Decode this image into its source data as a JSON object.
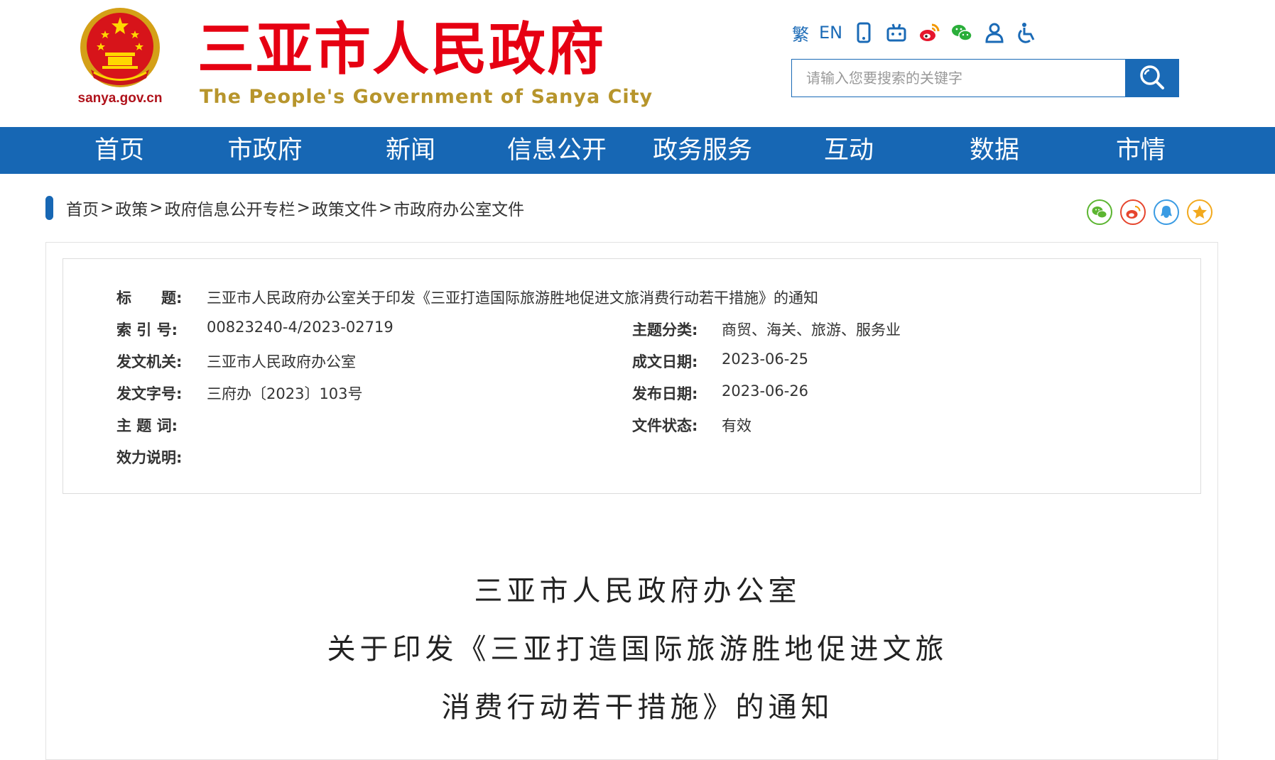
{
  "header": {
    "emblem_caption": "sanya.gov.cn",
    "site_title": "三亚市人民政府",
    "site_subtitle": "The People's Government of Sanya City",
    "tools": {
      "traditional": "繁",
      "english": "EN",
      "icons": [
        "mobile-icon",
        "robot-icon",
        "weibo-icon",
        "wechat-icon",
        "user-icon",
        "accessibility-icon"
      ]
    },
    "search": {
      "placeholder": "请输入您要搜索的关键字"
    }
  },
  "nav": {
    "items": [
      {
        "label": "首页"
      },
      {
        "label": "市政府"
      },
      {
        "label": "新闻"
      },
      {
        "label": "信息公开"
      },
      {
        "label": "政务服务"
      },
      {
        "label": "互动"
      },
      {
        "label": "数据"
      },
      {
        "label": "市情"
      }
    ]
  },
  "breadcrumb": {
    "items": [
      "首页",
      "政策",
      "政府信息公开专栏",
      "政策文件",
      "市政府办公室文件"
    ],
    "separator": ">"
  },
  "share": {
    "icons": [
      "wechat-share-icon",
      "weibo-share-icon",
      "qq-share-icon",
      "favorite-star-icon"
    ],
    "colors": {
      "wechat": "#5cb531",
      "weibo": "#e6452d",
      "qq": "#3a9be3",
      "favorite": "#f2a91d"
    }
  },
  "meta": {
    "title_label": "标　　题:",
    "title_value": "三亚市人民政府办公室关于印发《三亚打造国际旅游胜地促进文旅消费行动若干措施》的通知",
    "index_label": "索 引 号:",
    "index_value": "00823240-4/2023-02719",
    "category_label": "主题分类:",
    "category_value": "商贸、海关、旅游、服务业",
    "issuer_label": "发文机关:",
    "issuer_value": "三亚市人民政府办公室",
    "written_date_label": "成文日期:",
    "written_date_value": "2023-06-25",
    "doc_number_label": "发文字号:",
    "doc_number_value": "三府办〔2023〕103号",
    "publish_date_label": "发布日期:",
    "publish_date_value": "2023-06-26",
    "keywords_label": "主 题 词:",
    "keywords_value": "",
    "status_label": "文件状态:",
    "status_value": "有效",
    "validity_label": "效力说明:",
    "validity_value": ""
  },
  "document": {
    "title_lines": [
      "三亚市人民政府办公室",
      "关于印发《三亚打造国际旅游胜地促进文旅",
      "消费行动若干措施》的通知"
    ]
  },
  "colors": {
    "brand_blue": "#1767b4",
    "title_red": "#e60012",
    "subtitle_gold": "#b7952c"
  }
}
